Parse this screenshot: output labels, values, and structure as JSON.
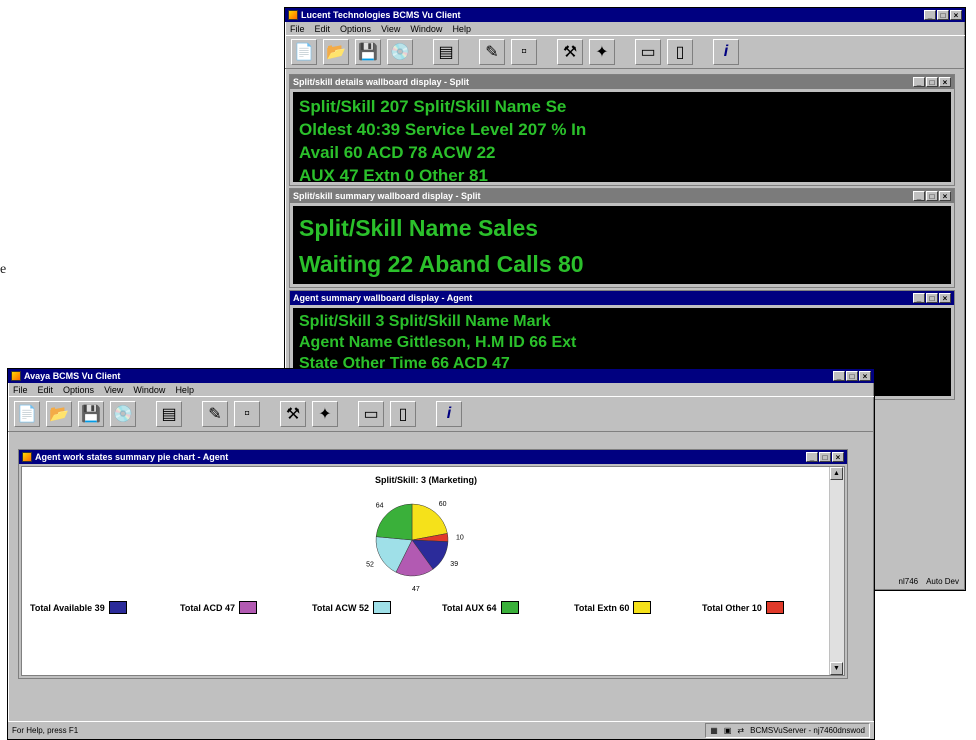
{
  "stray_text": "e",
  "back_window": {
    "title": "Lucent Technologies BCMS Vu Client",
    "menu": [
      "File",
      "Edit",
      "Options",
      "View",
      "Window",
      "Help"
    ],
    "status_right": [
      "nl746",
      "Auto Dev"
    ],
    "children": [
      {
        "title": "Split/skill details wallboard display - Split",
        "lines": [
          "Split/Skill 207 Split/Skill Name Se",
          "Oldest 40:39 Service Level 207 % In",
          "Avail 60 ACD 78 ACW 22",
          "AUX 47 Extn 0 Other 81"
        ]
      },
      {
        "title": "Split/skill summary wallboard display - Split",
        "lines": [
          "Split/Skill Name Sales",
          "Waiting 22 Aband Calls 80"
        ]
      },
      {
        "title": "Agent summary wallboard display - Agent",
        "lines": [
          "Split/Skill 3 Split/Skill Name Mark",
          "Agent Name Gittleson, H.M ID 66 Ext",
          "State Other Time 66 ACD 47"
        ]
      }
    ]
  },
  "front_window": {
    "title": "Avaya BCMS Vu Client",
    "menu": [
      "File",
      "Edit",
      "Options",
      "View",
      "Window",
      "Help"
    ],
    "chart_window_title": "Agent work states summary pie chart - Agent",
    "status_left": "For Help, press F1",
    "status_right": "BCMSVuServer - nj7460dnswod"
  },
  "toolbar_icons": [
    "new-icon",
    "open-icon",
    "save-icon",
    "disk-icon",
    "report-icon",
    "edit-icon",
    "blank-icon",
    "tools-icon",
    "color-icon",
    "tile-horizontal-icon",
    "tile-vertical-icon",
    "info-icon"
  ],
  "chart_data": {
    "type": "pie",
    "title": "Split/Skill: 3 (Marketing)",
    "labels": [
      "Total Available",
      "Total ACD",
      "Total ACW",
      "Total AUX",
      "Total Extn",
      "Total Other"
    ],
    "values": [
      39,
      47,
      52,
      64,
      60,
      10
    ],
    "colors": [
      "#2b2b9a",
      "#b25ab2",
      "#9fe0e8",
      "#3ab03a",
      "#f5e11a",
      "#e03a2a"
    ],
    "slice_order": [
      "Total Extn",
      "Total Other",
      "Total Available",
      "Total ACD",
      "Total ACW",
      "Total AUX"
    ],
    "legend": "bottom"
  }
}
